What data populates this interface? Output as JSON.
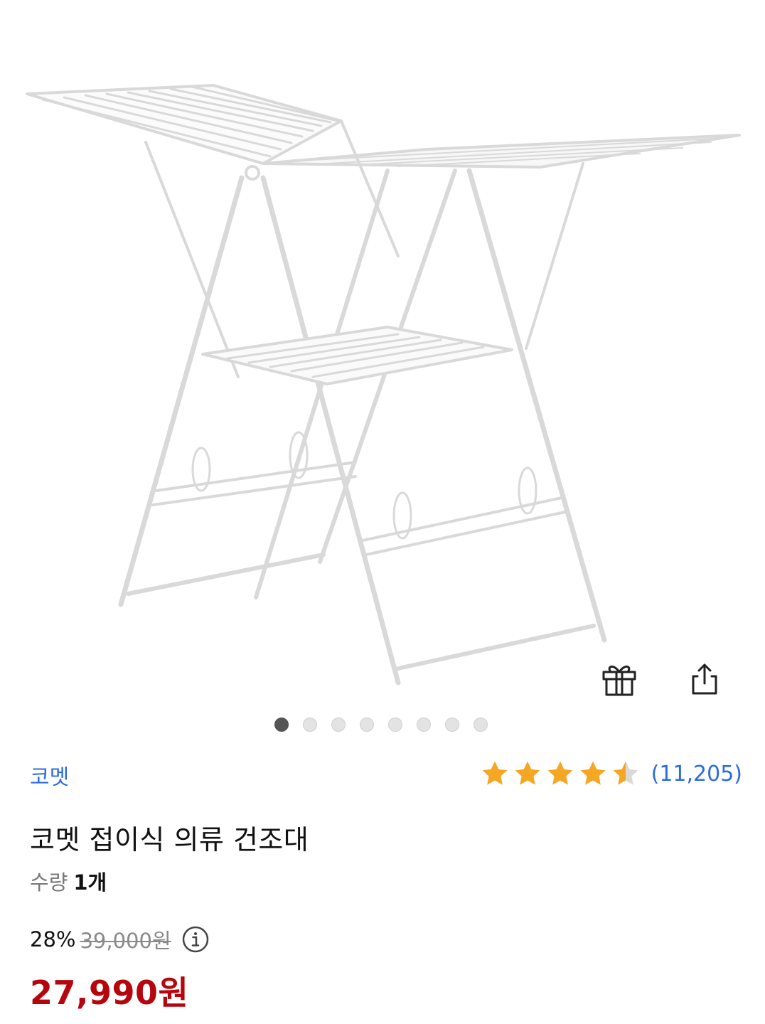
{
  "product": {
    "brand": "코멧",
    "title": "코멧 접이식 의류 건조대",
    "quantity_label": "수량",
    "quantity_value": "1개",
    "rating": 4.5,
    "rating_count": "(11,205)",
    "discount_rate": "28%",
    "original_price": "39,000원",
    "sale_price": "27,990원"
  },
  "carousel": {
    "total": 8,
    "active_index": 0
  },
  "icons": {
    "gift": "gift-icon",
    "share": "share-icon",
    "info": "info-icon",
    "star": "star-icon"
  },
  "colors": {
    "brand_link": "#2d6cdf",
    "sale_price": "#b5060e",
    "star_fill": "#f5a623",
    "dot_active": "#555555",
    "dot_inactive": "#e3e3e3"
  }
}
